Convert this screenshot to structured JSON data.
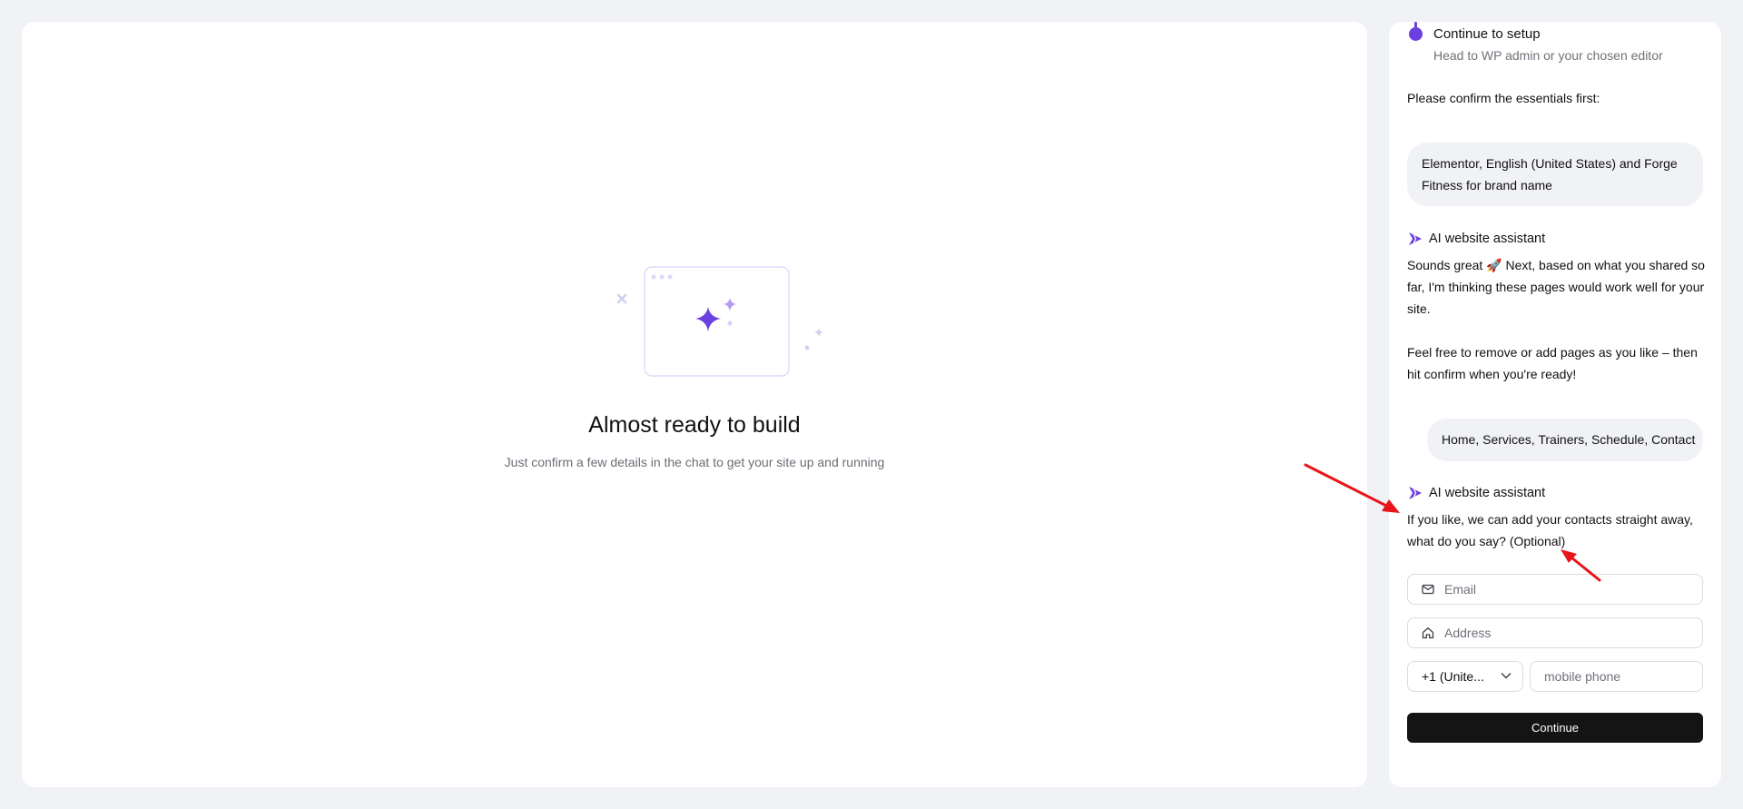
{
  "main": {
    "title": "Almost ready to build",
    "subtitle": "Just confirm a few details in the chat to get your site up and running"
  },
  "chat": {
    "step": {
      "title": "Continue to setup",
      "subtitle": "Head to WP admin or your chosen editor"
    },
    "prompt": "Please confirm the essentials first:",
    "user_reply_1": "Elementor, English (United States) and Forge Fitness for brand name",
    "assistant_name": "AI website assistant",
    "assistant_msg_1": "Sounds great 🚀 Next, based on what you shared so far, I'm thinking these pages would work well for your site.",
    "assistant_msg_2": "Feel free to remove or add pages as you like – then hit confirm when you're ready!",
    "user_reply_2": "Home, Services, Trainers, Schedule, Contact",
    "assistant_msg_3": "If you like, we can add your contacts straight away, what do you say? (Optional)",
    "form": {
      "email_placeholder": "Email",
      "address_placeholder": "Address",
      "country_code": "+1 (Unite...",
      "phone_placeholder": "mobile phone",
      "continue_label": "Continue"
    }
  },
  "colors": {
    "accent": "#6b3fe0",
    "annotation_arrow": "#e8161b",
    "button": "#141414"
  }
}
